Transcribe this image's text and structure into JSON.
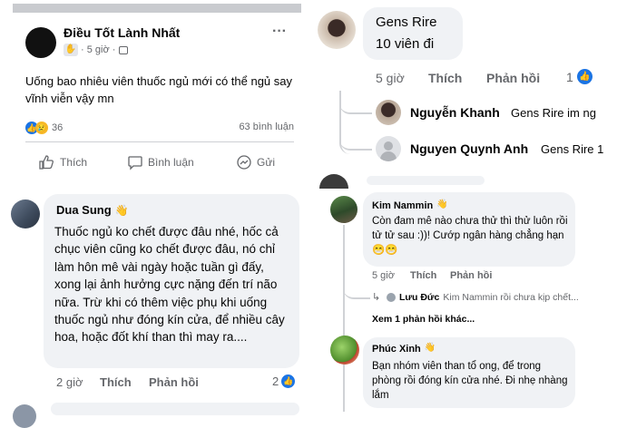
{
  "post": {
    "author": "Điều Tốt Lành Nhất",
    "meta": "· 5 giờ ·",
    "text": "Uống bao nhiêu viên thuốc ngủ mới có thể ngủ say vĩnh viễn vậy mn",
    "reaction_count": "36",
    "comment_count": "63 bình luận",
    "more": "···",
    "actions": {
      "like": "Thích",
      "comment": "Bình luận",
      "share": "Gửi"
    }
  },
  "comment_dua": {
    "author": "Dua Sung",
    "text": "Thuốc ngủ ko chết được đâu nhé, hốc cả chục viên cũng ko chết được đâu, nó chỉ làm hôn mê vài ngày hoặc tuần gì đấy, xong lại ảnh hưởng cực nặng đến trí não nữa. Trừ khi có thêm việc phụ khi uống thuốc ngủ như đóng kín cửa, để nhiều cây hoa, hoặc đốt khí than thì may ra....",
    "time": "2 giờ",
    "like": "Thích",
    "reply": "Phản hồi",
    "likes": "2"
  },
  "comment_gens": {
    "author": "Gens Rire",
    "text": "10 viên đi",
    "time": "5 giờ",
    "like": "Thích",
    "reply": "Phản hồi",
    "likes": "1",
    "replies": [
      {
        "author": "Nguyễn Khanh",
        "preview": "Gens Rire im ng"
      },
      {
        "author": "Nguyen Quynh Anh",
        "preview": "Gens Rire 1"
      }
    ]
  },
  "comment_kim": {
    "author": "Kim Nammin",
    "text": "Còn đam mê nào chưa thử thì thử luôn rồi tử tử sau :))! Cướp ngân hàng chẳng hạn 😁😁",
    "time": "5 giờ",
    "like": "Thích",
    "reply": "Phản hồi",
    "sub_reply_author": "Lưu Đức",
    "sub_reply_preview": "Kim Nammin rồi chưa kịp chết...",
    "more_replies": "Xem 1 phản hồi khác..."
  },
  "comment_phuc": {
    "author": "Phúc Xinh",
    "text": "Bạn nhóm viên than tổ ong, để trong phòng rồi đóng kín cửa nhé. Đi nhẹ nhàng lắm"
  },
  "colors": {
    "like_blue": "#1b74e4",
    "bubble": "#f0f2f5",
    "haha_yellow": "#f7b928"
  }
}
